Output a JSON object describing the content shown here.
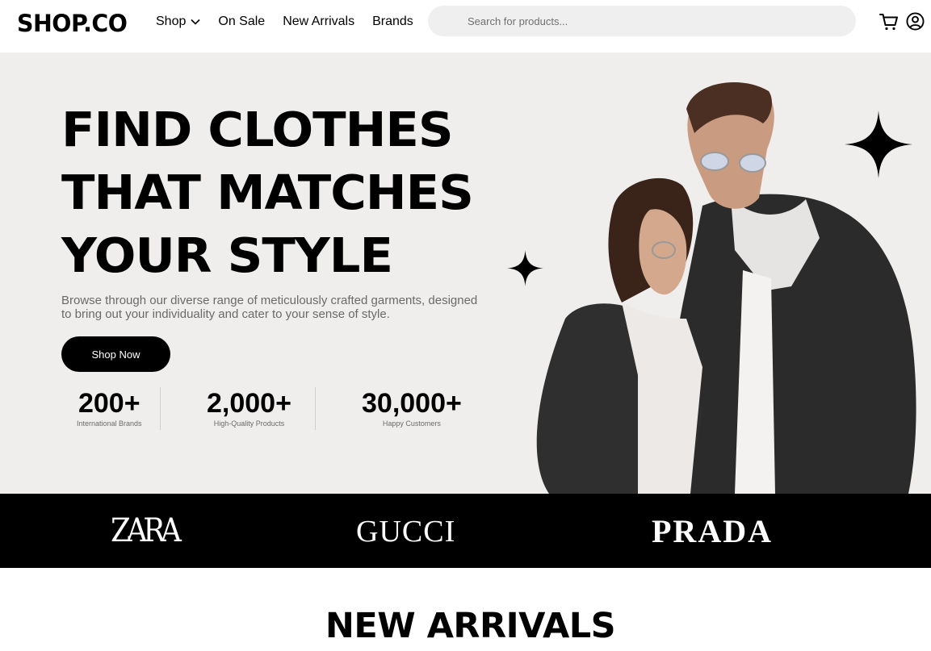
{
  "header": {
    "logo": "SHOP.CO",
    "nav": [
      {
        "label": "Shop",
        "has_dropdown": true
      },
      {
        "label": "On Sale"
      },
      {
        "label": "New Arrivals"
      },
      {
        "label": "Brands"
      }
    ],
    "search": {
      "placeholder": "Search for products...",
      "value": ""
    },
    "icons": [
      "cart-icon",
      "user-account-icon"
    ]
  },
  "hero": {
    "title_lines": [
      "FIND CLOTHES",
      "THAT MATCHES",
      "YOUR STYLE"
    ],
    "description": "Browse through our diverse range of meticulously crafted garments, designed to bring out your individuality and cater to your sense of style.",
    "cta_label": "Shop Now",
    "stats": [
      {
        "value": "200+",
        "label": "International Brands"
      },
      {
        "value": "2,000+",
        "label": "High-Quality Products"
      },
      {
        "value": "30,000+",
        "label": "Happy Customers"
      }
    ]
  },
  "brands": [
    "ZARA",
    "GUCCI",
    "PRADA"
  ],
  "new_arrivals": {
    "title": "NEW ARRIVALS"
  },
  "colors": {
    "hero_bg": "#f0eeed",
    "brands_bg": "#000000",
    "search_bg": "#efefef",
    "text_muted": "#6a6a6a",
    "cta_bg": "#000000"
  }
}
